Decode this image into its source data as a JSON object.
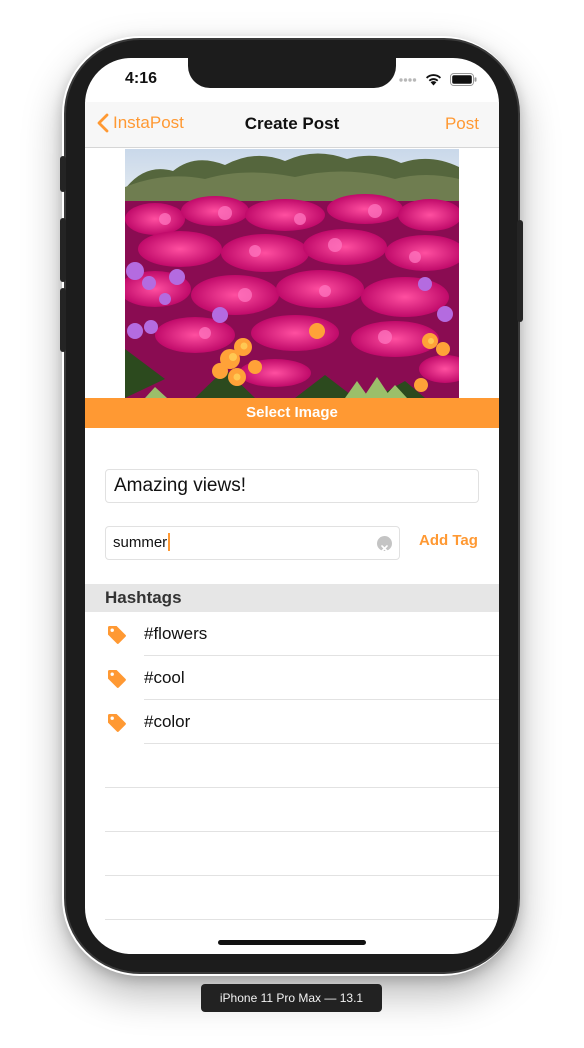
{
  "status_bar": {
    "time": "4:16"
  },
  "navbar": {
    "back_label": "InstaPost",
    "title": "Create Post",
    "post_label": "Post"
  },
  "select_image_label": "Select Image",
  "caption": {
    "value": "Amazing views!"
  },
  "tag_input": {
    "value": "summer"
  },
  "add_tag_label": "Add Tag",
  "hashtags": {
    "header": "Hashtags",
    "items": [
      {
        "label": "#flowers",
        "icon": "tag-icon"
      },
      {
        "label": "#cool",
        "icon": "tag-icon"
      },
      {
        "label": "#color",
        "icon": "tag-icon"
      }
    ]
  },
  "device_label": "iPhone 11 Pro Max — 13.1",
  "colors": {
    "accent": "#ff9933",
    "section_bg": "#e6e6e6",
    "nav_bg": "#f7f7f7"
  }
}
